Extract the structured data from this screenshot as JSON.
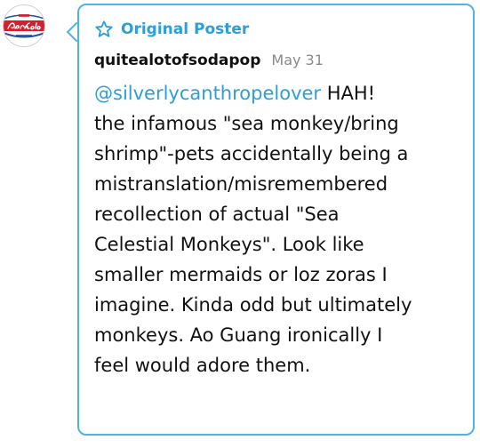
{
  "avatar": {
    "logo_text": "Pepsi:Cola",
    "top_text": "DRINK",
    "bottom_text": "ICE-COLD",
    "colors": {
      "red": "#d0222e",
      "blue": "#1f4fa3"
    }
  },
  "post": {
    "badge_label": "Original Poster",
    "badge_icon": "star-icon",
    "username": "quitealotofsodapop",
    "date": "May 31",
    "mention": "@silverlycanthropelover",
    "first_line_rest": " HAH!",
    "lines": [
      "the infamous \"sea monkey/bring",
      "shrimp\"-pets accidentally being a",
      "mistranslation/misremembered",
      "recollection of actual \"Sea",
      "Celestial Monkeys\". Look like",
      "smaller mermaids or loz zoras I",
      "imagine. Kinda odd but ultimately",
      "monkeys. Ao Guang ironically I",
      "feel would adore them."
    ]
  },
  "colors": {
    "accent": "#2e9fd6",
    "border": "#4fb3e6",
    "text": "#111111",
    "muted": "#8a8a8a"
  }
}
